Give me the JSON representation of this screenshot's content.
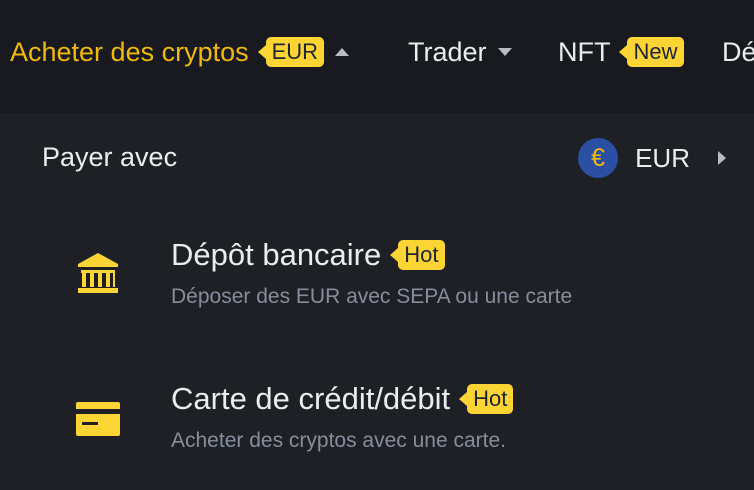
{
  "nav": {
    "items": [
      {
        "label": "Acheter des cryptos",
        "badge": "EUR",
        "active": true
      },
      {
        "label": "Trader"
      },
      {
        "label": "NFT",
        "badge": "New"
      },
      {
        "label": "Dé"
      }
    ]
  },
  "panel": {
    "pay_with_label": "Payer avec",
    "currency": {
      "symbol": "€",
      "code": "EUR"
    },
    "options": [
      {
        "title": "Dépôt bancaire",
        "badge": "Hot",
        "description": "Déposer des EUR avec SEPA ou une carte",
        "icon": "bank-icon"
      },
      {
        "title": "Carte de crédit/débit",
        "badge": "Hot",
        "description": "Acheter des cryptos avec une carte.",
        "icon": "credit-card-icon"
      }
    ]
  },
  "colors": {
    "accent": "#f0b90b",
    "badge": "#fcd535",
    "background": "#181a20",
    "panel": "#1e2026",
    "text_primary": "#eaecef",
    "text_secondary": "#848e9c"
  }
}
